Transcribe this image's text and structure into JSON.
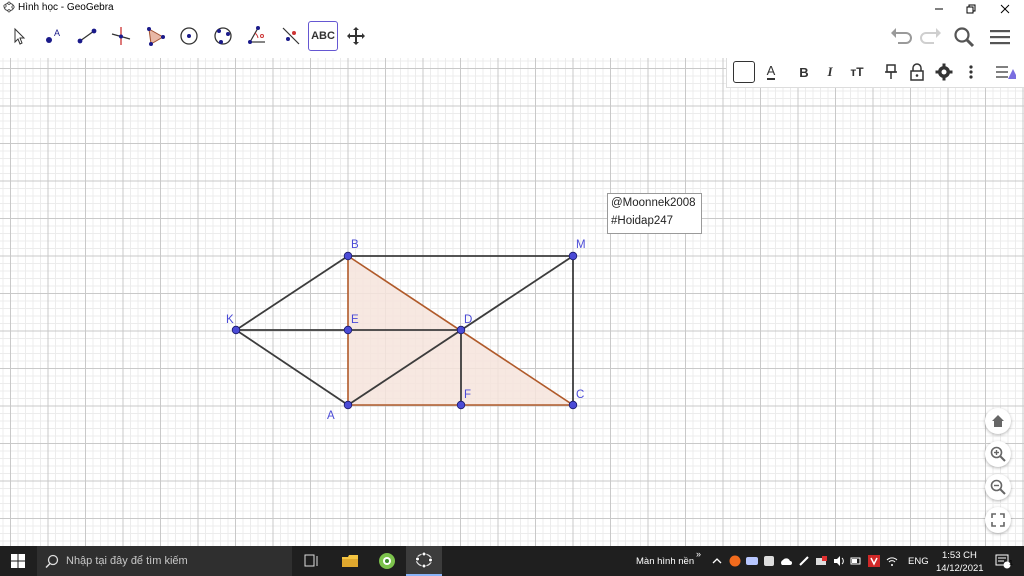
{
  "window": {
    "title": "Hình học - GeoGebra"
  },
  "toolbar": {
    "tools": [
      {
        "name": "move-tool",
        "icon": "cursor-icon"
      },
      {
        "name": "point-tool",
        "icon": "point-icon",
        "label": "A"
      },
      {
        "name": "segment-tool",
        "icon": "segment-icon"
      },
      {
        "name": "perpendicular-tool",
        "icon": "perpendicular-icon"
      },
      {
        "name": "polygon-tool",
        "icon": "polygon-icon"
      },
      {
        "name": "circle-tool",
        "icon": "circle-center-icon"
      },
      {
        "name": "circle-three-points-tool",
        "icon": "circle-three-points-icon"
      },
      {
        "name": "angle-tool",
        "icon": "angle-icon"
      },
      {
        "name": "reflect-tool",
        "icon": "reflect-icon"
      },
      {
        "name": "text-tool",
        "icon": "text-icon",
        "label": "ABC",
        "selected": true
      },
      {
        "name": "move-view-tool",
        "icon": "move-view-icon"
      }
    ]
  },
  "stylebar": {
    "text_color_label": "A",
    "bold_label": "B",
    "italic_label": "I",
    "size_label": "тT"
  },
  "text_object": {
    "line1": "@Moonnek2008",
    "line2": "#Hoidap247"
  },
  "points": {
    "B": "B",
    "M": "M",
    "K": "K",
    "E": "E",
    "D": "D",
    "A": "A",
    "F": "F",
    "C": "C"
  },
  "colors": {
    "point_fill": "#4b4bd6",
    "segment": "#3c3c3c",
    "triangle_stroke": "#b05a2a",
    "triangle_fill": "#f6e4dc",
    "label": "#4b4bd6",
    "accent": "#6557d2"
  },
  "taskbar": {
    "search_placeholder": "Nhập tại đây để tìm kiếm",
    "desktop_label": "Màn hình nền",
    "lang": "ENG",
    "time": "1:53 CH",
    "date": "14/12/2021",
    "notification_count": "1"
  }
}
